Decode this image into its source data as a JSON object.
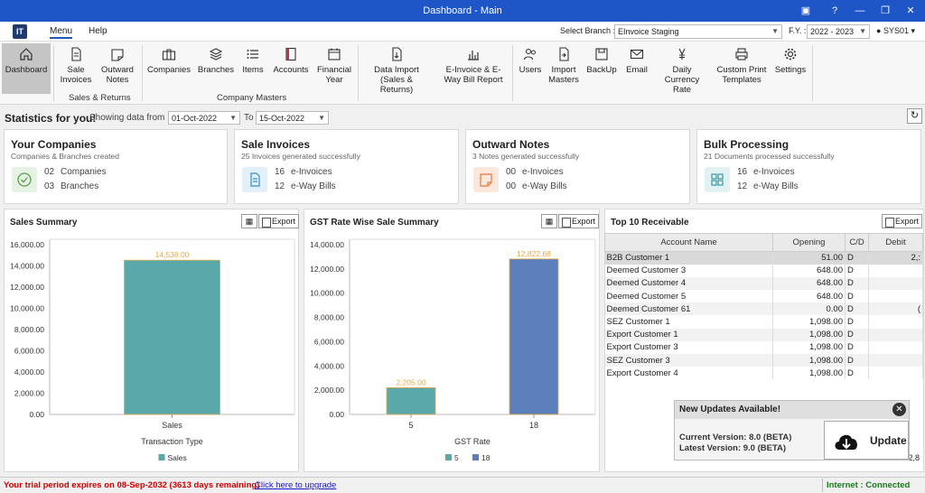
{
  "window": {
    "title": "Dashboard - Main"
  },
  "menu": {
    "tabs": [
      "Menu",
      "Help"
    ],
    "logo": "IT"
  },
  "header": {
    "branch_label": "Select Branch :",
    "branch_value": "EInvoice Staging",
    "fy_label": "F.Y. :",
    "fy_value": "2022 - 2023",
    "user": "SYS01"
  },
  "ribbon": {
    "dashboard": "Dashboard",
    "sale_invoices": "Sale Invoices",
    "outward_notes": "Outward Notes",
    "group_sales": "Sales & Returns",
    "companies": "Companies",
    "branches": "Branches",
    "items": "Items",
    "accounts": "Accounts",
    "financial_year": "Financial Year",
    "group_masters": "Company Masters",
    "data_import": "Data Import (Sales & Returns)",
    "einvoice_report": "E-Invoice & E-Way Bill Report",
    "users": "Users",
    "import_masters": "Import Masters",
    "backup": "BackUp",
    "email": "Email",
    "daily_rate": "Daily Currency Rate",
    "custom_print": "Custom Print Templates",
    "settings": "Settings"
  },
  "stats": {
    "title": "Statistics for you!",
    "showing_label": "Showing data from",
    "from_date": "01-Oct-2022",
    "to_label": "To",
    "to_date": "15-Oct-2022"
  },
  "cards": [
    {
      "title": "Your Companies",
      "subtitle": "Companies & Branches created",
      "rows": [
        {
          "n": "02",
          "label": "Companies"
        },
        {
          "n": "03",
          "label": "Branches"
        }
      ],
      "color": "#e6f2e3"
    },
    {
      "title": "Sale Invoices",
      "subtitle": "25 Invoices generated successfully",
      "rows": [
        {
          "n": "16",
          "label": "e-Invoices"
        },
        {
          "n": "12",
          "label": "e-Way Bills"
        }
      ],
      "color": "#e1f0f9"
    },
    {
      "title": "Outward Notes",
      "subtitle": "3 Notes generated successfully",
      "rows": [
        {
          "n": "00",
          "label": "e-Invoices"
        },
        {
          "n": "00",
          "label": "e-Way Bills"
        }
      ],
      "color": "#fbe7dc"
    },
    {
      "title": "Bulk Processing",
      "subtitle": "21 Documents processed successfully",
      "rows": [
        {
          "n": "16",
          "label": "e-Invoices"
        },
        {
          "n": "12",
          "label": "e-Way Bills"
        }
      ],
      "color": "#e2f1f2"
    }
  ],
  "export_label": "Export",
  "chart_data": [
    {
      "type": "bar",
      "title": "Sales Summary",
      "categories": [
        "Sales"
      ],
      "values": [
        14538.0
      ],
      "value_labels": [
        "14,538.00"
      ],
      "xlabel": "Transaction Type",
      "ylabel": "",
      "ylim": [
        0,
        16000
      ],
      "yticks": [
        "16,000.00",
        "14,000.00",
        "12,000.00",
        "10,000.00",
        "8,000.00",
        "6,000.00",
        "4,000.00",
        "2,000.00",
        "0.00"
      ],
      "legend": [
        "Sales"
      ],
      "colors": [
        "#5aa9a8"
      ]
    },
    {
      "type": "bar",
      "title": "GST Rate Wise Sale Summary",
      "categories": [
        "5",
        "18"
      ],
      "values": [
        2205.0,
        12822.68
      ],
      "value_labels": [
        "2,205.00",
        "12,822.68"
      ],
      "xlabel": "GST Rate",
      "ylabel": "",
      "ylim": [
        0,
        14000
      ],
      "yticks": [
        "14,000.00",
        "12,000.00",
        "10,000.00",
        "8,000.00",
        "6,000.00",
        "4,000.00",
        "2,000.00",
        "0.00"
      ],
      "legend": [
        "5",
        "18"
      ],
      "colors": [
        "#5aa9a8",
        "#5a7fba"
      ]
    }
  ],
  "receivable": {
    "title": "Top 10 Receivable",
    "columns": [
      "Account Name",
      "Opening",
      "C/D",
      "Debit"
    ],
    "rows": [
      [
        "B2B Customer 1",
        "51.00",
        "D",
        "2,:"
      ],
      [
        "Deemed Customer 3",
        "648.00",
        "D",
        ""
      ],
      [
        "Deemed Customer 4",
        "648.00",
        "D",
        ""
      ],
      [
        "Deemed Customer 5",
        "648.00",
        "D",
        ""
      ],
      [
        "Deemed Customer 61",
        "0.00",
        "D",
        "("
      ],
      [
        "SEZ Customer 1",
        "1,098.00",
        "D",
        ""
      ],
      [
        "Export Customer 1",
        "1,098.00",
        "D",
        ""
      ],
      [
        "Export Customer 3",
        "1,098.00",
        "D",
        ""
      ],
      [
        "SEZ Customer 3",
        "1,098.00",
        "D",
        ""
      ],
      [
        "Export Customer 4",
        "1,098.00",
        "D",
        ""
      ]
    ],
    "footer_value": "2,8"
  },
  "update_popup": {
    "title": "New Updates Available!",
    "current": "Current Version: 8.0 (BETA)",
    "latest": "Latest Version: 9.0 (BETA)",
    "button": "Update"
  },
  "status": {
    "trial": "Your trial period expires on 08-Sep-2032 (3613 days remaining)",
    "upgrade_link": "Click here to upgrade",
    "internet": "Internet : Connected"
  }
}
